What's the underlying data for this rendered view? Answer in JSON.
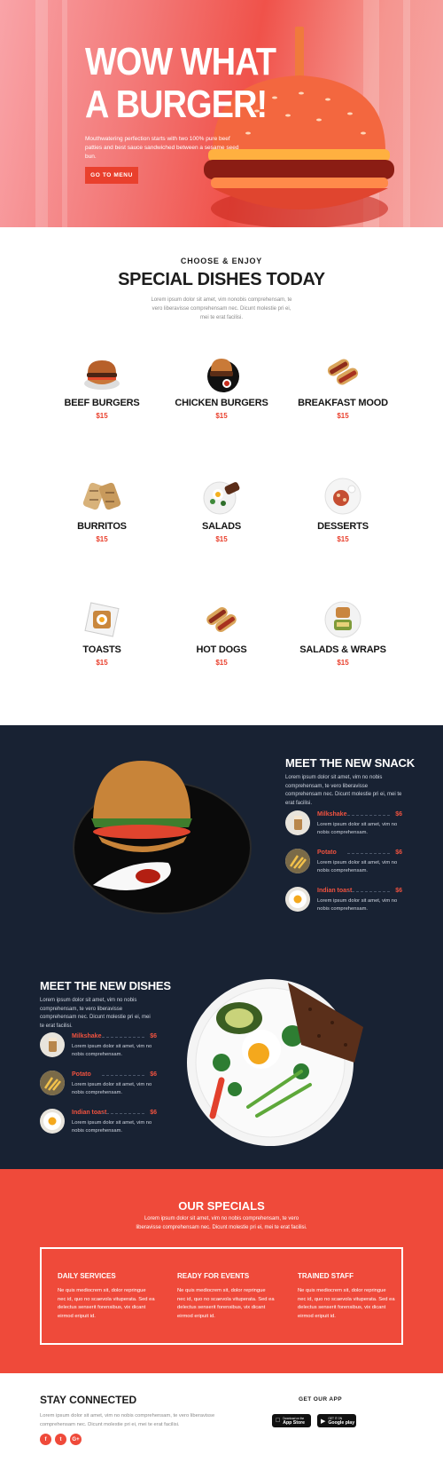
{
  "hero": {
    "title_line1": "WOW WHAT",
    "title_line2": "A BURGER!",
    "subtitle": "Mouthwatering perfection starts with two 100% pure beef patties and best sauce sandwiched between a sesame seed bun.",
    "button": "GO TO MENU"
  },
  "dishes": {
    "eyebrow": "CHOOSE & ENJOY",
    "title": "SPECIAL DISHES TODAY",
    "description": "Lorem ipsum dolor sit amet, vim nonobis comprehensam, te vero liberavisse comprehensam nec. Dicunt molestie pri ei, mei te erat facilisi.",
    "items": [
      {
        "name": "BEEF BURGERS",
        "price": "$15",
        "icon": "burger-photo"
      },
      {
        "name": "CHICKEN BURGERS",
        "price": "$15",
        "icon": "chicken-burger-photo"
      },
      {
        "name": "BREAKFAST MOOD",
        "price": "$15",
        "icon": "hotdog-photo"
      },
      {
        "name": "BURRITOS",
        "price": "$15",
        "icon": "burrito-photo"
      },
      {
        "name": "SALADS",
        "price": "$15",
        "icon": "salad-photo"
      },
      {
        "name": "DESSERTS",
        "price": "$15",
        "icon": "dessert-photo"
      },
      {
        "name": "TOASTS",
        "price": "$15",
        "icon": "toast-photo"
      },
      {
        "name": "HOT DOGS",
        "price": "$15",
        "icon": "hotdog-photo"
      },
      {
        "name": "SALADS & WRAPS",
        "price": "$15",
        "icon": "wrap-photo"
      }
    ]
  },
  "snack": {
    "title": "MEET THE NEW SNACK",
    "description": "Lorem ipsum dolor sit amet, vim no nobis comprehensam, te vero liberavisse comprehensam nec. Dicunt molestie pri ei, mei te erat facilisi.",
    "items": [
      {
        "name": "Milkshake",
        "price": "$6",
        "desc": "Lorem ipsum dolor sit amet, vim no nobis comprehensam."
      },
      {
        "name": "Potato",
        "price": "$6",
        "desc": "Lorem ipsum dolor sit amet, vim no nobis comprehensam."
      },
      {
        "name": "Indian toast",
        "price": "$6",
        "desc": "Lorem ipsum dolor sit amet, vim no nobis comprehensam."
      }
    ]
  },
  "new_dishes": {
    "title": "MEET THE NEW DISHES",
    "description": "Lorem ipsum dolor sit amet, vim no nobis comprehensam, te vero liberavisse comprehensam nec. Dicunt molestie pri ei, mei te erat facilisi.",
    "items": [
      {
        "name": "Milkshake",
        "price": "$6",
        "desc": "Lorem ipsum dolor sit amet, vim no nobis comprehensam."
      },
      {
        "name": "Potato",
        "price": "$6",
        "desc": "Lorem ipsum dolor sit amet, vim no nobis comprehensam."
      },
      {
        "name": "Indian toast",
        "price": "$6",
        "desc": "Lorem ipsum dolor sit amet, vim no nobis comprehensam."
      }
    ]
  },
  "specials": {
    "title": "OUR SPECIALS",
    "description": "Lorem ipsum dolor sit amet, vim no nobis comprehensam, te vero liberavisse comprehensam nec. Dicunt molestie pri ei, mei te erat facilisi.",
    "columns": [
      {
        "heading": "DAILY SERVICES",
        "text": "Ne quis mediocrem sit, dolor repringue nec id, quo no scaevola vituperata. Sed ea delectus senserit forensibus, vix dicant eirmod eripuit id."
      },
      {
        "heading": "READY FOR EVENTS",
        "text": "Ne quis mediocrem sit, dolor repringue nec id, quo no scaevola vituperata. Sed ea delectus senserit forensibus, vix dicant eirmod eripuit id."
      },
      {
        "heading": "TRAINED STAFF",
        "text": "Ne quis mediocrem sit, dolor repringue nec id, quo no scaevola vituperata. Sed ea delectus senserit forensibus, vix dicant eirmod eripuit id."
      }
    ]
  },
  "footer": {
    "title": "STAY CONNECTED",
    "description": "Lorem ipsum dolor sit amet, vim no nobis comprehensam, te vero liberavisse comprehensam nec. Dicunt molestie pri ei, mei te erat facilisi.",
    "social": [
      {
        "icon": "facebook-icon",
        "glyph": "f"
      },
      {
        "icon": "twitter-icon",
        "glyph": "t"
      },
      {
        "icon": "google-plus-icon",
        "glyph": "G+"
      }
    ],
    "app_title": "GET OUR APP",
    "app_store": {
      "small": "Download on the",
      "big": "App Store"
    },
    "google_play": {
      "small": "GET IT ON",
      "big": "Google play"
    }
  },
  "colors": {
    "accent": "#ef4a3a",
    "dark": "#182233",
    "hero": "#f0524a"
  }
}
